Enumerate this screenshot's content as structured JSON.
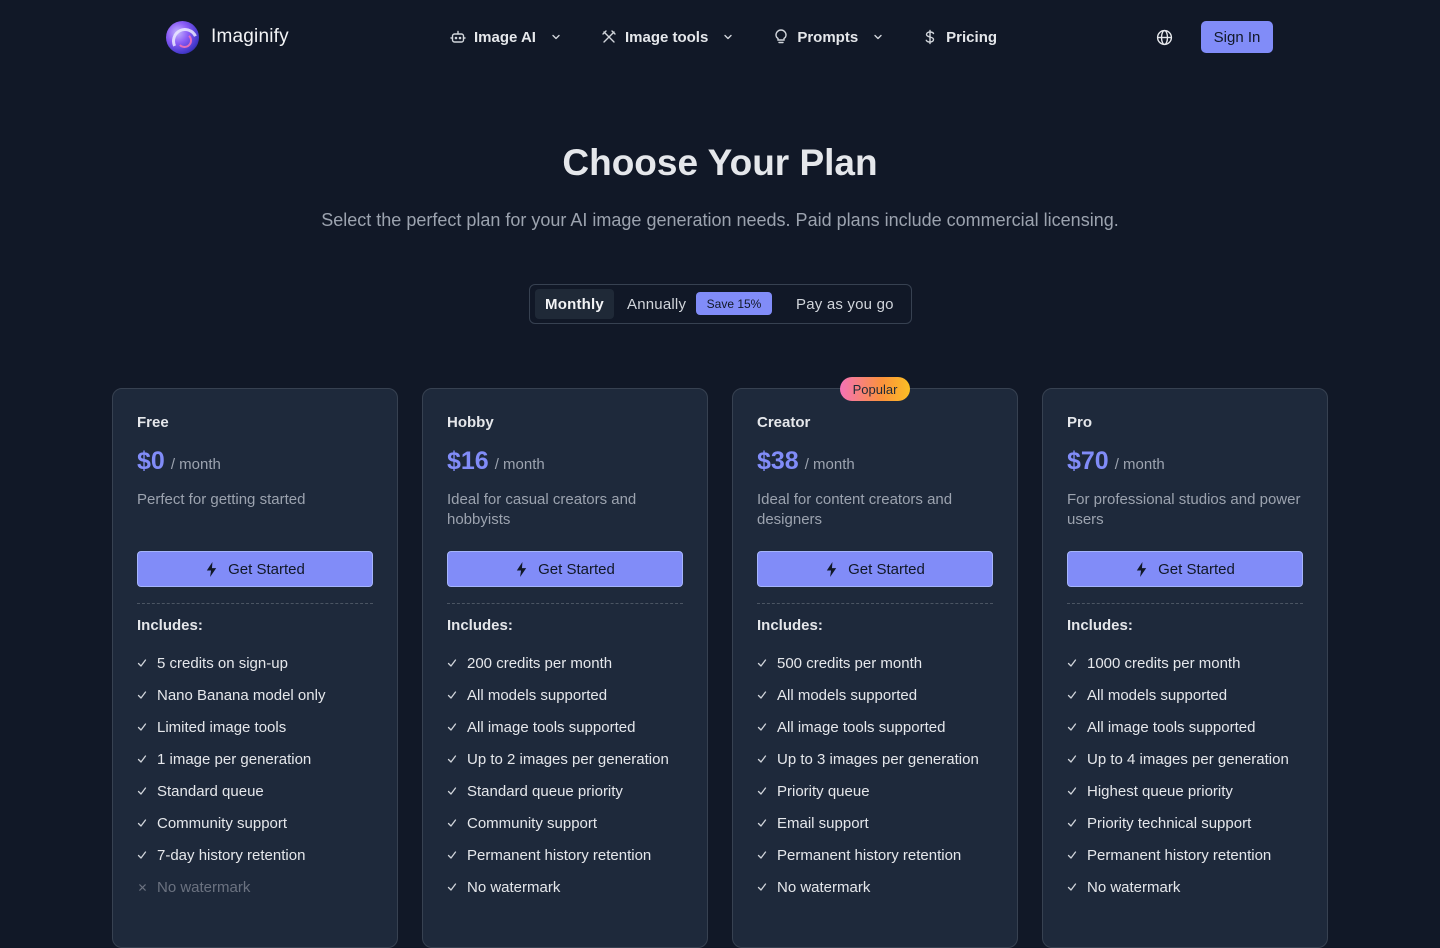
{
  "header": {
    "brand": "Imaginify",
    "nav": [
      {
        "label": "Image AI",
        "icon": "robot-icon",
        "dropdown": true
      },
      {
        "label": "Image tools",
        "icon": "tools-icon",
        "dropdown": true
      },
      {
        "label": "Prompts",
        "icon": "lightbulb-icon",
        "dropdown": true
      },
      {
        "label": "Pricing",
        "icon": "dollar-icon",
        "dropdown": false
      }
    ],
    "language_icon": "globe-icon",
    "signin_label": "Sign In"
  },
  "hero": {
    "title": "Choose Your Plan",
    "subtitle": "Select the perfect plan for your AI image generation needs. Paid plans include commercial licensing."
  },
  "billing": {
    "options": [
      "Monthly",
      "Annually",
      "Pay as you go"
    ],
    "selected": "Monthly",
    "annual_badge": "Save 15%"
  },
  "colors": {
    "background": "#111827",
    "card": "#1e293b",
    "accent": "#818cf8"
  },
  "plans": [
    {
      "name": "Free",
      "price": "$0",
      "period": "/ month",
      "description": "Perfect for getting started",
      "cta": "Get Started",
      "includes_label": "Includes:",
      "features": [
        {
          "text": "5 credits on sign-up",
          "included": true
        },
        {
          "text": "Nano Banana model only",
          "included": true
        },
        {
          "text": "Limited image tools",
          "included": true
        },
        {
          "text": "1 image per generation",
          "included": true
        },
        {
          "text": "Standard queue",
          "included": true
        },
        {
          "text": "Community support",
          "included": true
        },
        {
          "text": "7-day history retention",
          "included": true
        },
        {
          "text": "No watermark",
          "included": false
        }
      ]
    },
    {
      "name": "Hobby",
      "price": "$16",
      "period": "/ month",
      "description": "Ideal for casual creators and hobbyists",
      "cta": "Get Started",
      "includes_label": "Includes:",
      "features": [
        {
          "text": "200 credits per month",
          "included": true
        },
        {
          "text": "All models supported",
          "included": true
        },
        {
          "text": "All image tools supported",
          "included": true
        },
        {
          "text": "Up to 2 images per generation",
          "included": true
        },
        {
          "text": "Standard queue priority",
          "included": true
        },
        {
          "text": "Community support",
          "included": true
        },
        {
          "text": "Permanent history retention",
          "included": true
        },
        {
          "text": "No watermark",
          "included": true
        }
      ]
    },
    {
      "name": "Creator",
      "price": "$38",
      "period": "/ month",
      "description": "Ideal for content creators and designers",
      "cta": "Get Started",
      "includes_label": "Includes:",
      "badge": "Popular",
      "features": [
        {
          "text": "500 credits per month",
          "included": true
        },
        {
          "text": "All models supported",
          "included": true
        },
        {
          "text": "All image tools supported",
          "included": true
        },
        {
          "text": "Up to 3 images per generation",
          "included": true
        },
        {
          "text": "Priority queue",
          "included": true
        },
        {
          "text": "Email support",
          "included": true
        },
        {
          "text": "Permanent history retention",
          "included": true
        },
        {
          "text": "No watermark",
          "included": true
        }
      ]
    },
    {
      "name": "Pro",
      "price": "$70",
      "period": "/ month",
      "description": "For professional studios and power users",
      "cta": "Get Started",
      "includes_label": "Includes:",
      "features": [
        {
          "text": "1000 credits per month",
          "included": true
        },
        {
          "text": "All models supported",
          "included": true
        },
        {
          "text": "All image tools supported",
          "included": true
        },
        {
          "text": "Up to 4 images per generation",
          "included": true
        },
        {
          "text": "Highest queue priority",
          "included": true
        },
        {
          "text": "Priority technical support",
          "included": true
        },
        {
          "text": "Permanent history retention",
          "included": true
        },
        {
          "text": "No watermark",
          "included": true
        }
      ]
    }
  ]
}
